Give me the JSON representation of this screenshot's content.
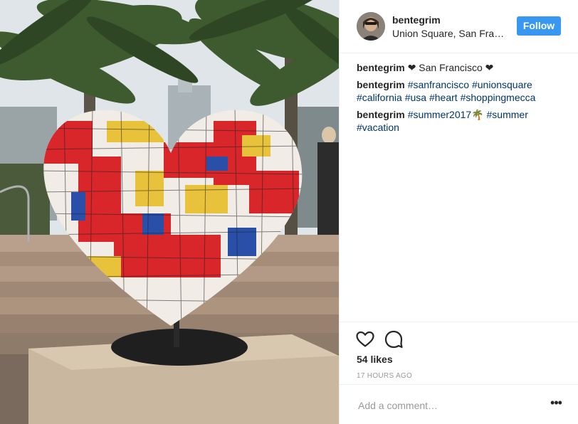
{
  "post": {
    "username": "bentegrim",
    "location": "Union Square, San Francisco",
    "follow_label": "Follow",
    "comments": [
      {
        "author": "bentegrim",
        "parts": [
          {
            "kind": "plain",
            "text": "❤ San Francisco ❤"
          }
        ]
      },
      {
        "author": "bentegrim",
        "parts": [
          {
            "kind": "tag",
            "text": "#sanfrancisco"
          },
          {
            "kind": "plain",
            "text": " "
          },
          {
            "kind": "tag",
            "text": "#unionsquare"
          },
          {
            "kind": "plain",
            "text": " "
          },
          {
            "kind": "tag",
            "text": "#california"
          },
          {
            "kind": "plain",
            "text": " "
          },
          {
            "kind": "tag",
            "text": "#usa"
          },
          {
            "kind": "plain",
            "text": " "
          },
          {
            "kind": "tag",
            "text": "#heart"
          },
          {
            "kind": "plain",
            "text": " "
          },
          {
            "kind": "tag",
            "text": "#shoppingmecca"
          }
        ]
      },
      {
        "author": "bentegrim",
        "parts": [
          {
            "kind": "tag",
            "text": "#summer2017"
          },
          {
            "kind": "plain",
            "text": "🌴 "
          },
          {
            "kind": "tag",
            "text": "#summer"
          },
          {
            "kind": "plain",
            "text": " "
          },
          {
            "kind": "tag",
            "text": "#vacation"
          }
        ]
      }
    ],
    "likes": "54 likes",
    "time_ago": "17 HOURS AGO",
    "comment_placeholder": "Add a comment…",
    "more_label": "•••"
  },
  "icons": {
    "like": "heart-outline-icon",
    "comment": "speech-bubble-icon",
    "more": "ellipsis-icon"
  },
  "colors": {
    "accent": "#3897f0",
    "hashtag": "#003569",
    "text": "#262626",
    "muted": "#999999",
    "divider": "#efefef"
  }
}
